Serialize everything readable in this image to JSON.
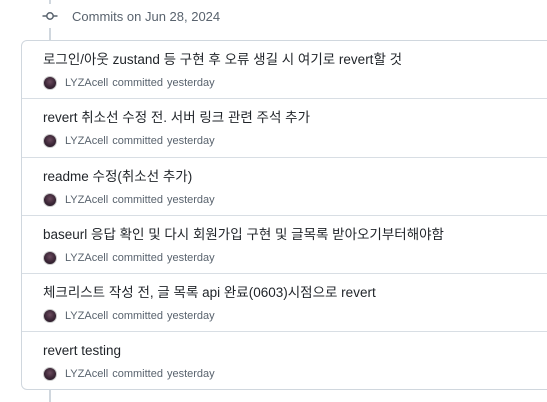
{
  "group": {
    "title": "Commits on Jun 28, 2024"
  },
  "commits": [
    {
      "title": "로그인/아웃 zustand 등 구현 후 오류 생길 시 여기로 revert할 것",
      "author": "LYZAcell",
      "action": "committed",
      "time": "yesterday"
    },
    {
      "title": "revert 취소선 수정 전. 서버 링크 관련 주석 추가",
      "author": "LYZAcell",
      "action": "committed",
      "time": "yesterday"
    },
    {
      "title": "readme 수정(취소선 추가)",
      "author": "LYZAcell",
      "action": "committed",
      "time": "yesterday"
    },
    {
      "title": "baseurl 응답 확인 및 다시 회원가입 구현 및 글목록 받아오기부터해야함",
      "author": "LYZAcell",
      "action": "committed",
      "time": "yesterday"
    },
    {
      "title": "체크리스트 작성 전, 글 목록 api 완료(0603)시점으로 revert",
      "author": "LYZAcell",
      "action": "committed",
      "time": "yesterday"
    },
    {
      "title": "revert testing",
      "author": "LYZAcell",
      "action": "committed",
      "time": "yesterday"
    }
  ],
  "icons": {
    "group_node": "git-commit-icon",
    "avatar": "user-avatar"
  },
  "colors": {
    "text_primary": "#1f2328",
    "text_muted": "#59636e",
    "border": "#d0d7de"
  }
}
